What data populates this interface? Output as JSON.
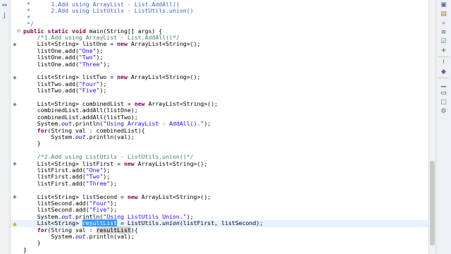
{
  "editor": {
    "code_lines": [
      {
        "text": " *      1.Add using ArrayList - List.AddAll()"
      },
      {
        "text": " *      2.Add using ListUtils - ListUtils.union()"
      },
      {
        "text": " *"
      },
      {
        "text": " */"
      },
      {
        "text": "public static void main(String[] args) {"
      },
      {
        "text": "    /*1.Add using ArrayList - List.AddAll()*/"
      },
      {
        "text": "    List<String> listOne = new ArrayList<String>();"
      },
      {
        "text": "    listOne.add(\"One\");"
      },
      {
        "text": "    listOne.add(\"Two\");"
      },
      {
        "text": "    listOne.add(\"Three\");"
      },
      {
        "text": ""
      },
      {
        "text": "    List<String> listTwo = new ArrayList<String>();"
      },
      {
        "text": "    listTwo.add(\"Four\");"
      },
      {
        "text": "    listTwo.add(\"Five\");"
      },
      {
        "text": ""
      },
      {
        "text": "    List<String> combinedList = new ArrayList<String>();"
      },
      {
        "text": "    combinedList.addAll(listOne);"
      },
      {
        "text": "    combinedList.addAll(listTwo);"
      },
      {
        "text": "    System.out.println(\"Using ArrayList - AddAll().\");"
      },
      {
        "text": "    for(String val : combinedList){"
      },
      {
        "text": "        System.out.println(val);"
      },
      {
        "text": "    }"
      },
      {
        "text": ""
      },
      {
        "text": "    /*2.Add using ListUtils - ListUtils.union()*/"
      },
      {
        "text": "    List<String> listFirst = new ArrayList<String>();"
      },
      {
        "text": "    listFirst.add(\"One\");"
      },
      {
        "text": "    listFirst.add(\"Two\");"
      },
      {
        "text": "    listFirst.add(\"Three\");"
      },
      {
        "text": ""
      },
      {
        "text": "    List<String> listSecond = new ArrayList<String>();"
      },
      {
        "text": "    listSecond.add(\"Four\");"
      },
      {
        "text": "    listSecond.add(\"Five\");"
      },
      {
        "text": "    System.out.println(\"Using ListUtils Union.\");"
      },
      {
        "text": "    List<String> resultList = ListUtils.union(listFirst, listSecond);"
      },
      {
        "text": "    for(String val : resultList){"
      },
      {
        "text": "        System.out.println(val);"
      },
      {
        "text": "    }"
      },
      {
        "text": "}"
      }
    ],
    "selected_word": "resultList",
    "current_line_index": 33
  },
  "gutter": {
    "fold_lines": [
      4
    ],
    "marker_lines": [
      6,
      11,
      15,
      24,
      29
    ],
    "warning_lines": [
      33
    ]
  },
  "icons": {
    "left_rail": [
      "collapse-icon",
      "java-file-icon"
    ],
    "right_rail": [
      "outline-icon",
      "package-icon",
      "search-icon",
      "list-icon",
      "task-icon",
      "green-plus-icon",
      "error-log-icon",
      "java-element-icon",
      "minimize-icon",
      "console-icon",
      "maximize-icon",
      "settings-icon"
    ]
  },
  "colors": {
    "keyword": "#7f0055",
    "string": "#2a00ff",
    "comment": "#3f7f5f",
    "javadoc": "#3f5fbf",
    "field": "#0000c0",
    "selection": "#3399ff",
    "current_line": "#e8f2fe"
  }
}
